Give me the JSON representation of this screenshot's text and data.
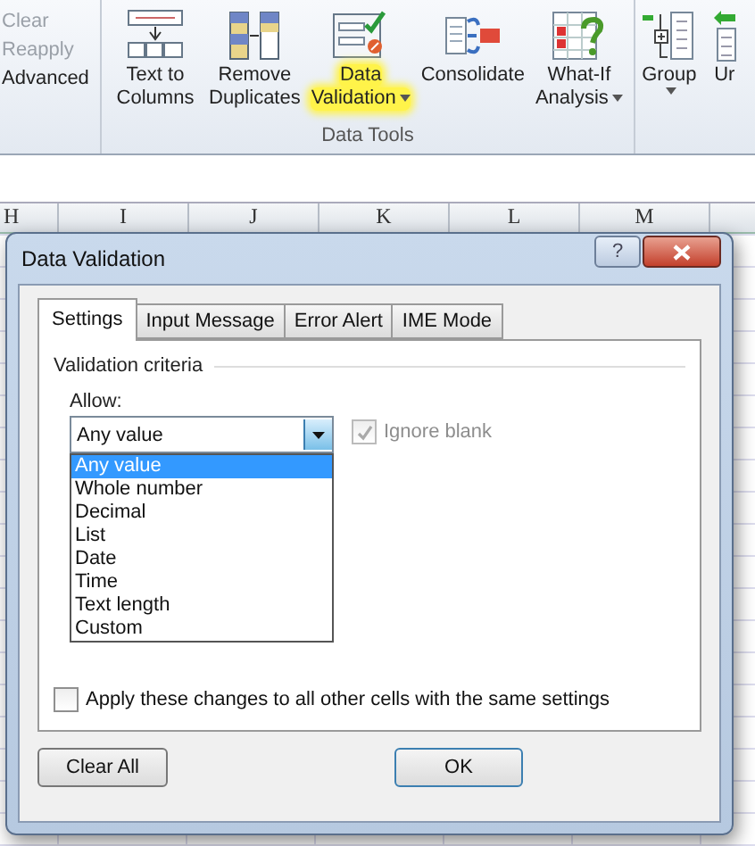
{
  "ribbon": {
    "left_commands": [
      {
        "label": "Clear",
        "disabled": true
      },
      {
        "label": "Reapply",
        "disabled": true
      },
      {
        "label": "Advanced",
        "disabled": false
      }
    ],
    "tools": [
      {
        "kind": "text-to-columns",
        "lines": [
          "Text to",
          "Columns"
        ],
        "dropdown": false,
        "highlighted": false
      },
      {
        "kind": "remove-duplicates",
        "lines": [
          "Remove",
          "Duplicates"
        ],
        "dropdown": false,
        "highlighted": false
      },
      {
        "kind": "data-validation",
        "lines": [
          "Data",
          "Validation"
        ],
        "dropdown": true,
        "highlighted": true
      },
      {
        "kind": "consolidate",
        "lines": [
          "Consolidate"
        ],
        "dropdown": false,
        "highlighted": false
      },
      {
        "kind": "what-if",
        "lines": [
          "What-If",
          "Analysis"
        ],
        "dropdown": true,
        "highlighted": false
      }
    ],
    "group_label": "Data Tools",
    "outline": [
      {
        "kind": "group",
        "lines": [
          "Group"
        ],
        "dropdown": true
      },
      {
        "kind": "ungroup",
        "lines": [
          "Ur"
        ],
        "dropdown": false
      }
    ]
  },
  "sheet": {
    "columns": [
      "H",
      "I",
      "J",
      "K",
      "L",
      "M"
    ]
  },
  "dialog": {
    "title": "Data Validation",
    "help_label": "?",
    "tabs": [
      {
        "label": "Settings",
        "selected": true
      },
      {
        "label": "Input Message",
        "selected": false
      },
      {
        "label": "Error Alert",
        "selected": false
      },
      {
        "label": "IME Mode",
        "selected": false
      }
    ],
    "section_label": "Validation criteria",
    "allow_label": "Allow:",
    "allow_value": "Any value",
    "ignore_blank": {
      "label": "Ignore blank",
      "checked": true,
      "disabled": true
    },
    "options": [
      {
        "label": "Any value",
        "selected": true
      },
      {
        "label": "Whole number",
        "selected": false
      },
      {
        "label": "Decimal",
        "selected": false
      },
      {
        "label": "List",
        "selected": false
      },
      {
        "label": "Date",
        "selected": false
      },
      {
        "label": "Time",
        "selected": false
      },
      {
        "label": "Text length",
        "selected": false
      },
      {
        "label": "Custom",
        "selected": false
      }
    ],
    "apply_all": {
      "label": "Apply these changes to all other cells with the same settings",
      "checked": false
    },
    "buttons": [
      {
        "label": "Clear All",
        "kind": "left"
      },
      {
        "label": "OK",
        "kind": "right"
      }
    ]
  }
}
